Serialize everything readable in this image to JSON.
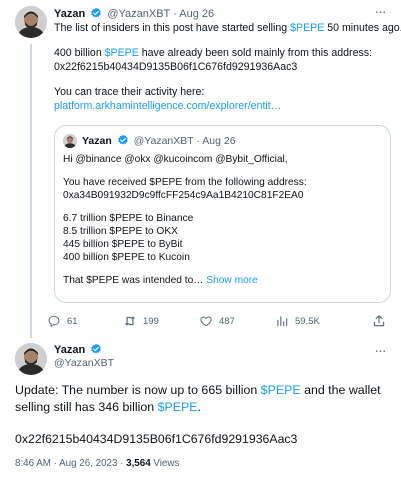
{
  "tweet1": {
    "name": "Yazan",
    "handle": "@YazanXBT",
    "dot": "·",
    "date": "Aug 26",
    "more": "···",
    "line1_pre": "The list of insiders in this post have started selling ",
    "line1_tag": "$PEPE",
    "line1_post": " 50 minutes ago.",
    "line2_pre": "400 billion ",
    "line2_tag": "$PEPE",
    "line2_post": " have already been sold mainly from this address:",
    "line3": "0x22f6215b40434D9135B06f1C676fd9291936Aac3",
    "line4": "You can trace their activity here:",
    "link": "platform.arkhamintelligence.com/explorer/entit…",
    "quote": {
      "name": "Yazan",
      "handle": "@YazanXBT",
      "dot": "·",
      "date": "Aug 26",
      "lines": [
        "Hi @binance @okx @kucoincom @Bybit_Official,",
        "You have received $PEPE from the following address:",
        "0xa34B091932D9c9ffcFF254c9Aa1B4210C81F2EA0",
        "6.7 trillion $PEPE to Binance",
        "8.5 trillion $PEPE to OKX",
        "445 billion $PEPE to ByBit",
        "400 billion $PEPE to Kucoin",
        "That $PEPE was intended to…"
      ],
      "show_more": "Show more"
    },
    "actions": {
      "replies": "61",
      "retweets": "199",
      "likes": "487",
      "views": "59.5K"
    }
  },
  "tweet2": {
    "name": "Yazan",
    "handle": "@YazanXBT",
    "more": "···",
    "text_pre": "Update: The number is now up to 665 billion ",
    "text_tag1": "$PEPE",
    "text_mid": " and the wallet selling still has 346 billion ",
    "text_tag2": "$PEPE",
    "text_post": ".",
    "address": "0x22f6215b40434D9135B06f1C676fd9291936Aac3",
    "time": "8:46 AM",
    "dot": " · ",
    "date": "Aug 26, 2023",
    "dot2": " · ",
    "views_count": "3,564",
    "views_label": " Views"
  },
  "colors": {
    "accent": "#1d9bf0",
    "muted": "#536471",
    "text": "#0f1419",
    "border": "#cfd9de"
  }
}
